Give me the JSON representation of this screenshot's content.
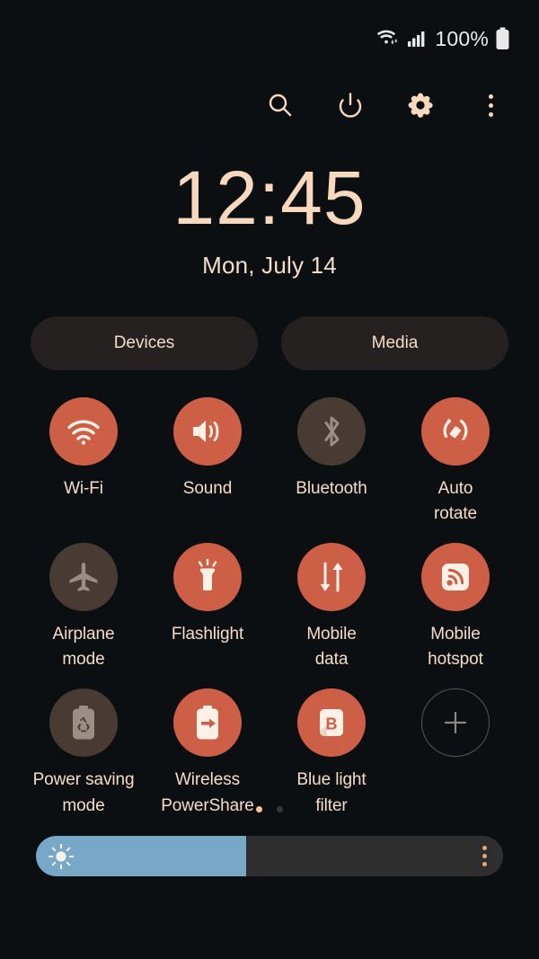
{
  "status_bar": {
    "wifi_icon": "wifi-with-arrows-icon",
    "signal_icon": "cellular-signal-icon",
    "battery_percent": "100%",
    "battery_icon": "battery-full-icon"
  },
  "toolbar": {
    "items": [
      {
        "name": "search-icon",
        "label": "Search"
      },
      {
        "name": "power-icon",
        "label": "Power"
      },
      {
        "name": "gear-icon",
        "label": "Settings"
      },
      {
        "name": "overflow-menu-icon",
        "label": "More options"
      }
    ]
  },
  "clock": {
    "time": "12:45",
    "date": "Mon, July 14"
  },
  "pills": {
    "devices_label": "Devices",
    "media_label": "Media"
  },
  "toggles": [
    {
      "label": "Wi-Fi",
      "icon": "wifi-icon",
      "state": "on"
    },
    {
      "label": "Sound",
      "icon": "volume-icon",
      "state": "on"
    },
    {
      "label": "Bluetooth",
      "icon": "bluetooth-icon",
      "state": "off"
    },
    {
      "label": "Auto\nrotate",
      "icon": "auto-rotate-icon",
      "state": "on"
    },
    {
      "label": "Airplane\nmode",
      "icon": "airplane-icon",
      "state": "off"
    },
    {
      "label": "Flashlight",
      "icon": "flashlight-icon",
      "state": "on"
    },
    {
      "label": "Mobile\ndata",
      "icon": "mobile-data-icon",
      "state": "on"
    },
    {
      "label": "Mobile\nhotspot",
      "icon": "hotspot-icon",
      "state": "on"
    },
    {
      "label": "Power saving\nmode",
      "icon": "power-saving-icon",
      "state": "off"
    },
    {
      "label": "Wireless\nPowerShare",
      "icon": "power-share-icon",
      "state": "on"
    },
    {
      "label": "Blue light\nfilter",
      "icon": "blue-light-filter-icon",
      "state": "on"
    },
    {
      "label": "",
      "icon": "plus-icon",
      "state": "add"
    }
  ],
  "pagination": {
    "total_pages": 2,
    "current_page": 1
  },
  "brightness": {
    "value_percent": 45,
    "sun_icon": "brightness-sun-icon",
    "menu_icon": "overflow-menu-icon"
  },
  "colors": {
    "background": "#0b0f12",
    "accent_on": "#cc5f46",
    "toggle_off": "#473b34",
    "text": "#f5dcc8",
    "clock": "#f8d9bd",
    "pill_bg": "#242120",
    "slider_fill": "#78a8c8",
    "slider_track": "#2e2e2e"
  }
}
